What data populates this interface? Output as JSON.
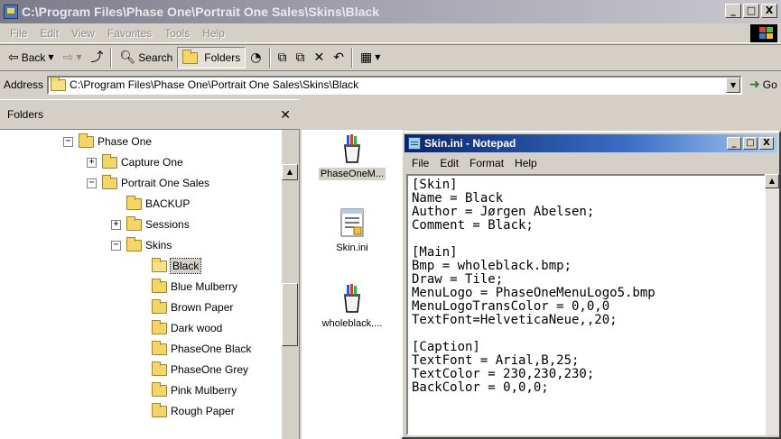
{
  "window": {
    "title": "C:\\Program Files\\Phase One\\Portrait One Sales\\Skins\\Black",
    "buttons": [
      "_",
      "□",
      "X"
    ]
  },
  "menubar": [
    "File",
    "Edit",
    "View",
    "Favorites",
    "Tools",
    "Help"
  ],
  "toolbar": {
    "back": "Back",
    "search": "Search",
    "folders": "Folders"
  },
  "address": {
    "label": "Address",
    "value": "C:\\Program Files\\Phase One\\Portrait One Sales\\Skins\\Black",
    "go": "Go"
  },
  "folders": {
    "header": "Folders",
    "items": [
      {
        "label": "Phase One",
        "expander": "−"
      },
      {
        "label": "Capture One",
        "expander": "+"
      },
      {
        "label": "Portrait One Sales",
        "expander": "−"
      },
      {
        "label": "BACKUP",
        "expander": ""
      },
      {
        "label": "Sessions",
        "expander": "+"
      },
      {
        "label": "Skins",
        "expander": "−"
      },
      {
        "label": "Black",
        "expander": "",
        "selected": true
      },
      {
        "label": "Blue Mulberry",
        "expander": ""
      },
      {
        "label": "Brown Paper",
        "expander": ""
      },
      {
        "label": "Dark wood",
        "expander": ""
      },
      {
        "label": "PhaseOne Black",
        "expander": ""
      },
      {
        "label": "PhaseOne Grey",
        "expander": ""
      },
      {
        "label": "Pink Mulberry",
        "expander": ""
      },
      {
        "label": "Rough Paper",
        "expander": ""
      }
    ]
  },
  "files": [
    {
      "name": "PhaseOneM...",
      "icon": "paint-bucket-icon"
    },
    {
      "name": "Skin.ini",
      "icon": "ini-file-icon"
    },
    {
      "name": "wholeblack....",
      "icon": "paint-bucket-icon"
    }
  ],
  "notepad": {
    "title": "Skin.ini - Notepad",
    "menu": [
      "File",
      "Edit",
      "Format",
      "Help"
    ],
    "lines": [
      "[Skin]",
      "Name = Black",
      "Author = Jørgen Abelsen;",
      "Comment = Black;",
      "",
      "[Main]",
      "Bmp = wholeblack.bmp;",
      "Draw = Tile;",
      "MenuLogo = PhaseOneMenuLogo5.bmp",
      "MenuLogoTransColor = 0,0,0",
      "TextFont=HelveticaNeue,,20;",
      "",
      "[Caption]",
      "TextFont = Arial,B,25;",
      "TextColor = 230,230,230;",
      "BackColor = 0,0,0;"
    ]
  }
}
